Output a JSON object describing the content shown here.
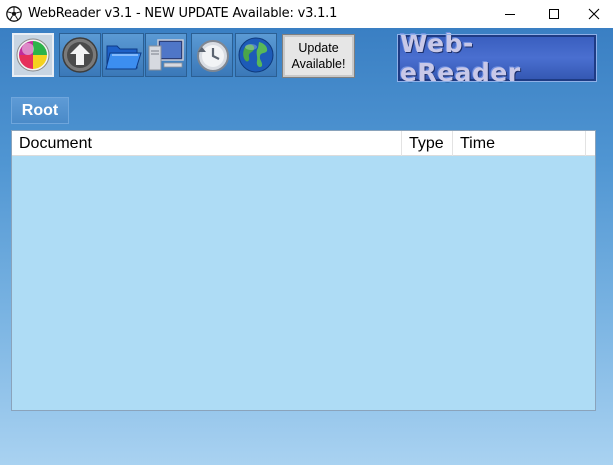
{
  "window": {
    "title": "WebReader v3.1 - NEW UPDATE Available: v3.1.1",
    "controls": [
      "minimize",
      "maximize",
      "close"
    ]
  },
  "toolbar": {
    "buttons": [
      {
        "name": "color-wheel-icon"
      },
      {
        "name": "up-arrow-icon"
      },
      {
        "name": "open-folder-icon"
      },
      {
        "name": "computer-icon"
      },
      {
        "name": "history-icon"
      },
      {
        "name": "globe-icon"
      }
    ],
    "update_line1": "Update",
    "update_line2": "Available!",
    "logo_text": "Web-eReader"
  },
  "breadcrumb": {
    "label": "Root"
  },
  "table": {
    "columns": [
      "Document",
      "Type",
      "Time"
    ],
    "rows": []
  }
}
